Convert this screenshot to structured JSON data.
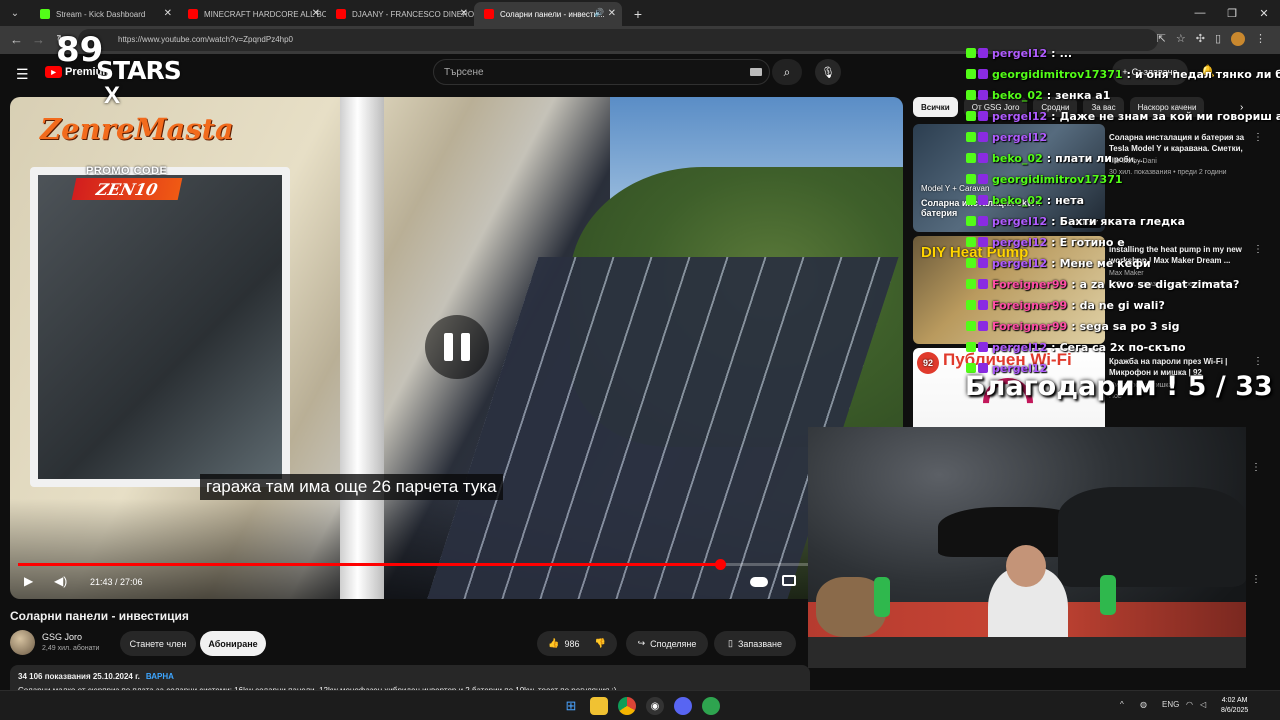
{
  "browser": {
    "tabs": [
      {
        "label": "Stream - Kick Dashboard",
        "active": false,
        "favicon_color": "#53fc18"
      },
      {
        "label": "MINECRAFT HARDCORE ALL BO...",
        "active": false,
        "favicon_color": "#ff0000"
      },
      {
        "label": "DJAANY - FRANCESCO DINERO",
        "active": false,
        "favicon_color": "#ff0000"
      },
      {
        "label": "Соларни панели - инвести...",
        "active": true,
        "favicon_color": "#ff0000"
      }
    ],
    "url": "https://www.youtube.com/watch?v=ZpqndPz4hp0"
  },
  "youtube": {
    "logo_text": "Premium",
    "search_placeholder": "Търсене",
    "create_label": "Създаване",
    "player": {
      "subtitle": "гаража там има още 26 парчета тука",
      "time": "21:43 / 27:06",
      "progress": 0.8
    },
    "overlay_logo": {
      "number": "89",
      "stars": "STARS",
      "x_mark": "X",
      "brand": "ZenreMasta",
      "promo_label": "PROMO CODE",
      "promo_code": "ZEN10"
    },
    "video": {
      "title": "Соларни панели - инвестиция",
      "channel": "GSG Joro",
      "subscribers": "2,49 хил. абонати",
      "join_label": "Станете член",
      "subscribe_label": "Абониране",
      "likes": "986",
      "share_label": "Споделяне",
      "save_label": "Запазване",
      "views_date": "34 106 показвания  25.10.2024 г.",
      "location_tag": "ВАРНА",
      "description": "Соларни малко от сюрприз по плата за соларни системи: 16kw соларни панели, 12kw монофазен хибриден инвертор и 2 батерии по 10kw, тоест по регуляция :)"
    },
    "chips": [
      "Всички",
      "От GSG Joro",
      "Сродни",
      "За вас",
      "Наскоро качени"
    ],
    "recommendations": [
      {
        "title": "Соларна инсталация и батерия за Tesla Model Y и каравана. Сметки, проби, ...",
        "channel": "Car life by Dani",
        "views": "30 хил. показвания • преди 2 години",
        "duration": "1:08:57",
        "thumb_caption": "Model Y + Caravan",
        "thumb_caption2": "Соларна инсталация 5kWч батерия"
      },
      {
        "title": "Installing the heat pump in my new workshop | Max Maker Dream ...",
        "channel": "Max Maker",
        "views": "500 хил. показвания • преди 1 година",
        "duration": "",
        "thumb_caption": "DIY Heat Pump",
        "thumb_caption2": ""
      },
      {
        "title": "Кражба на пароли през Wi-Fi | Микрофон и мишка | 92",
        "channel": "Микрофон и мишка",
        "views": "Нов",
        "duration": "",
        "thumb_caption": "Публичен Wi-Fi",
        "thumb_caption2": "92"
      }
    ]
  },
  "chat": {
    "messages": [
      {
        "user": "pergel12",
        "text": "...",
        "color": "#b05cff"
      },
      {
        "user": "georgidimitrov17371",
        "text": "и оня педал тянко ли беше",
        "color": "#53fc18"
      },
      {
        "user": "beko_02",
        "text": "зенка а1",
        "color": "#53fc18"
      },
      {
        "user": "pergel12",
        "text": "Даже не знам за кой ми говориш ама д",
        "color": "#b05cff"
      },
      {
        "user": "pergel12",
        "text": "",
        "color": "#b05cff"
      },
      {
        "user": "beko_02",
        "text": "плати ли",
        "color": "#53fc18"
      },
      {
        "user": "georgidimitrov17371",
        "text": "",
        "color": "#53fc18"
      },
      {
        "user": "beko_02",
        "text": "нета",
        "color": "#53fc18"
      },
      {
        "user": "pergel12",
        "text": "Бахти яката гледка",
        "color": "#b05cff"
      },
      {
        "user": "pergel12",
        "text": "Е готино е",
        "color": "#b05cff"
      },
      {
        "user": "pergel12",
        "text": "Мене ме кефи",
        "color": "#b05cff"
      },
      {
        "user": "Foreigner99",
        "text": "a za kwo se digat zimata?",
        "color": "#ff4da6"
      },
      {
        "user": "Foreigner99",
        "text": "da ne gi wali?",
        "color": "#ff4da6"
      },
      {
        "user": "Foreigner99",
        "text": "sega sa po 3 sig",
        "color": "#ff4da6"
      },
      {
        "user": "pergel12",
        "text": "Сега са 2x по-скъпо",
        "color": "#b05cff"
      },
      {
        "user": "pergel12",
        "text": "",
        "color": "#b05cff"
      }
    ],
    "thanks_banner": "Благодарим ! 5 / 33"
  },
  "taskbar": {
    "language": "ENG",
    "time": "4:02 AM",
    "date": "8/6/2025"
  }
}
